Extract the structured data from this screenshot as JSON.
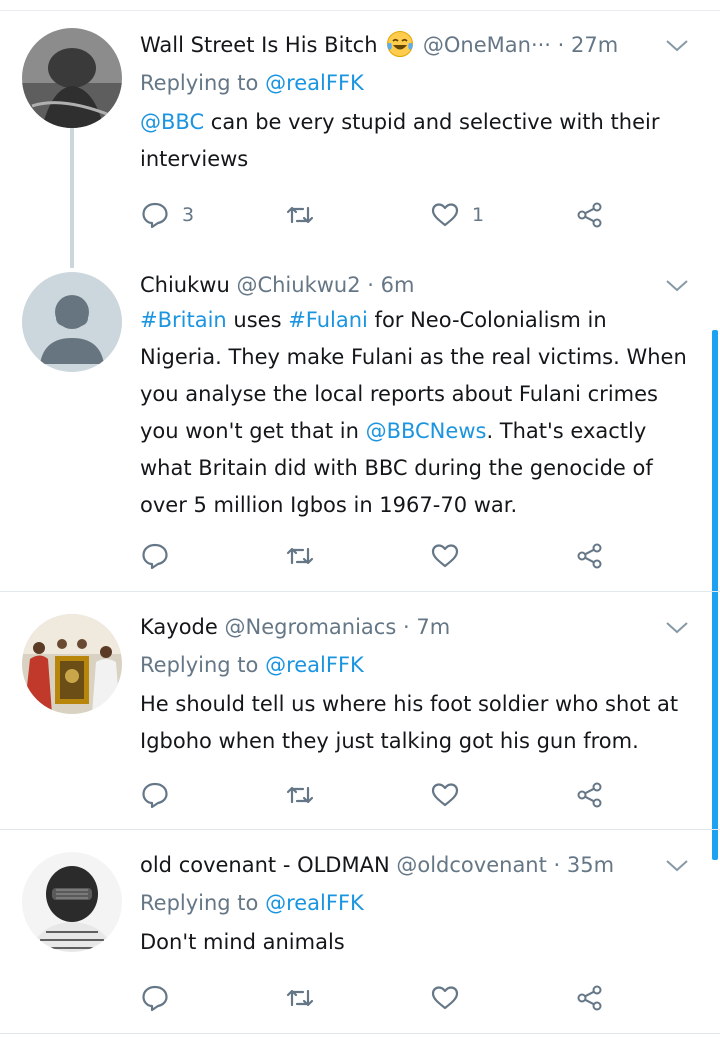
{
  "tweets": [
    {
      "display_name": "Wall Street Is His Bitch",
      "emoji": "😂",
      "handle": "@OneMan···",
      "time": "27m",
      "replying_prefix": "Replying to",
      "replying_to": "@realFFK",
      "text_link": "@BBC",
      "text": "can be very stupid and selective with their interviews",
      "reply_count": "3",
      "like_count": "1"
    },
    {
      "display_name": "Chiukwu",
      "handle": "@Chiukwu2",
      "time": "6m",
      "body": {
        "tag1": "#Britain",
        "t1": " uses ",
        "tag2": "#Fulani",
        "t2": " for Neo-Colonialism in Nigeria. They make Fulani as the real victims. When you analyse the local reports about Fulani crimes you won't get that in ",
        "mention": "@BBCNews",
        "t3": ". That's exactly what Britain did with BBC during the genocide of over 5 million Igbos in 1967-70 war."
      }
    },
    {
      "display_name": "Kayode",
      "handle": "@Negromaniacs",
      "time": "7m",
      "replying_prefix": "Replying to",
      "replying_to": "@realFFK",
      "text": "He should tell us where his foot soldier who shot at Igboho when they just talking got his gun from."
    },
    {
      "display_name": "old covenant - OLDMAN",
      "handle": "@oldcovenant",
      "time": "35m",
      "replying_prefix": "Replying to",
      "replying_to": "@realFFK",
      "text": "Don't mind animals"
    }
  ],
  "separator": "·",
  "colors": {
    "link": "#1b95e0",
    "muted": "#657786",
    "text": "#14171a",
    "divider": "#e1e8ed",
    "scrollbar": "#1da1f2"
  }
}
